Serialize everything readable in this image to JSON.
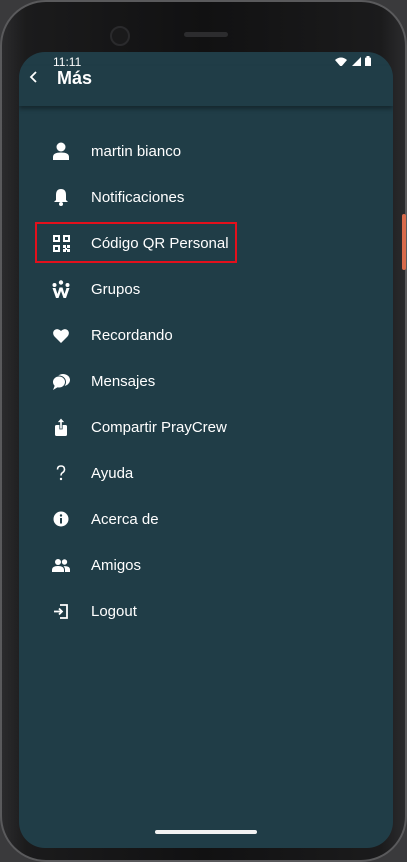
{
  "status_bar": {
    "time": "11:11",
    "icons": [
      "wifi-icon",
      "signal-icon",
      "battery-icon"
    ]
  },
  "app_bar": {
    "back_icon": "chevron-left-icon",
    "title": "Más"
  },
  "menu": {
    "items": [
      {
        "label": "martin bianco",
        "icon": "person-icon"
      },
      {
        "label": "Notificaciones",
        "icon": "bell-icon"
      },
      {
        "label": "Código QR Personal",
        "icon": "qr-code-icon",
        "highlighted": true
      },
      {
        "label": "Grupos",
        "icon": "groups-icon"
      },
      {
        "label": "Recordando",
        "icon": "heart-icon"
      },
      {
        "label": "Mensajes",
        "icon": "chat-bubbles-icon"
      },
      {
        "label": "Compartir PrayCrew",
        "icon": "share-icon"
      },
      {
        "label": "Ayuda",
        "icon": "help-icon"
      },
      {
        "label": "Acerca de",
        "icon": "info-icon"
      },
      {
        "label": "Amigos",
        "icon": "friends-icon"
      },
      {
        "label": "Logout",
        "icon": "logout-icon"
      }
    ]
  },
  "colors": {
    "background": "#203d47",
    "text": "#ffffff",
    "highlight_border": "#e3101c"
  }
}
